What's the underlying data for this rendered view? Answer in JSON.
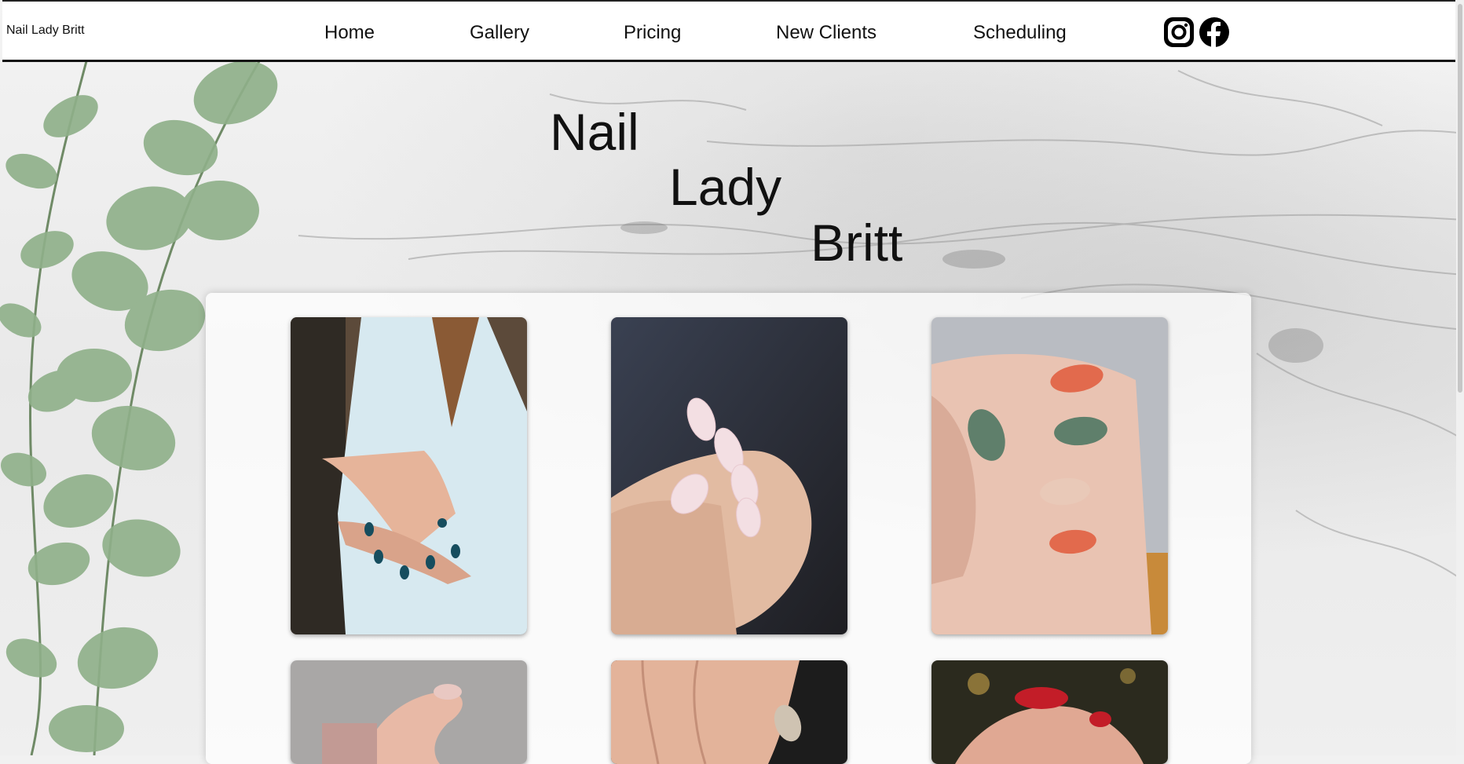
{
  "header": {
    "brand": "Nail Lady Britt",
    "nav": [
      "Home",
      "Gallery",
      "Pricing",
      "New Clients",
      "Scheduling"
    ],
    "social": [
      "instagram-icon",
      "facebook-icon"
    ]
  },
  "hero": {
    "title_lines": [
      "Nail",
      "Lady",
      "Britt"
    ]
  },
  "gallery": {
    "photos": [
      {
        "desc": "bride-hands-blue-nails"
      },
      {
        "desc": "almond-opal-glitter-nails"
      },
      {
        "desc": "coral-green-floral-nails"
      },
      {
        "desc": "pink-nails-sweater"
      },
      {
        "desc": "neutral-nails-art"
      },
      {
        "desc": "red-nails"
      }
    ]
  },
  "colors": {
    "header_bg": "#ffffff",
    "text": "#111111",
    "panel_bg": "rgba(255,255,255,0.72)"
  }
}
